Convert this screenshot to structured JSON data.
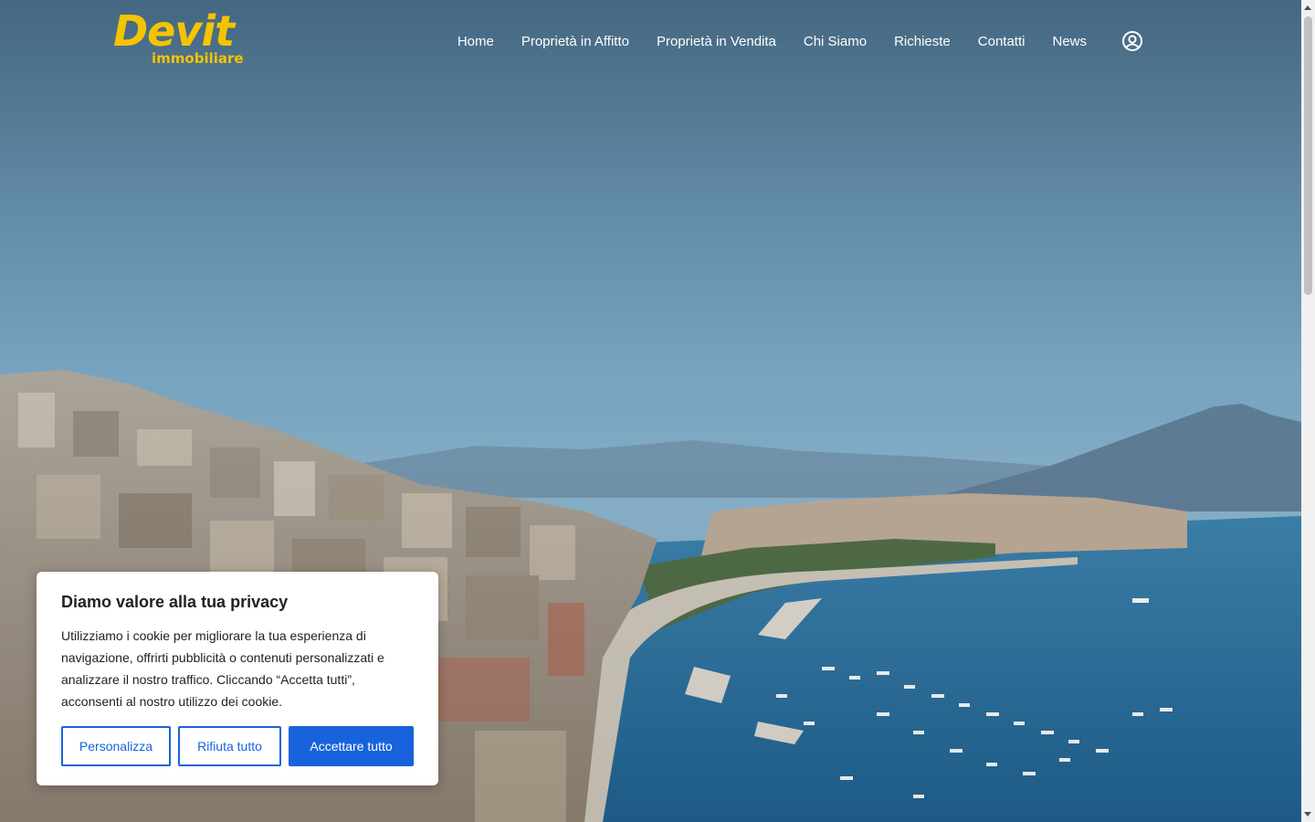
{
  "brand": {
    "logo_main": "Devit",
    "logo_sub": "immobiliare",
    "color": "#f5c400"
  },
  "nav": {
    "items": [
      {
        "label": "Home"
      },
      {
        "label": "Proprietà in Affitto"
      },
      {
        "label": "Proprietà in Vendita"
      },
      {
        "label": "Chi Siamo"
      },
      {
        "label": "Richieste"
      },
      {
        "label": "Contatti"
      },
      {
        "label": "News"
      }
    ],
    "user_icon": "user-circle-icon"
  },
  "cookie_banner": {
    "title": "Diamo valore alla tua privacy",
    "text": "Utilizziamo i cookie per migliorare la tua esperienza di navigazione, offrirti pubblicità o contenuti personalizzati e analizzare il nostro traffico. Cliccando “Accetta tutti”, acconsenti al nostro utilizzo dei cookie.",
    "buttons": {
      "customize": "Personalizza",
      "reject": "Rifiuta tutto",
      "accept": "Accettare tutto"
    },
    "accent_color": "#1863dc"
  }
}
